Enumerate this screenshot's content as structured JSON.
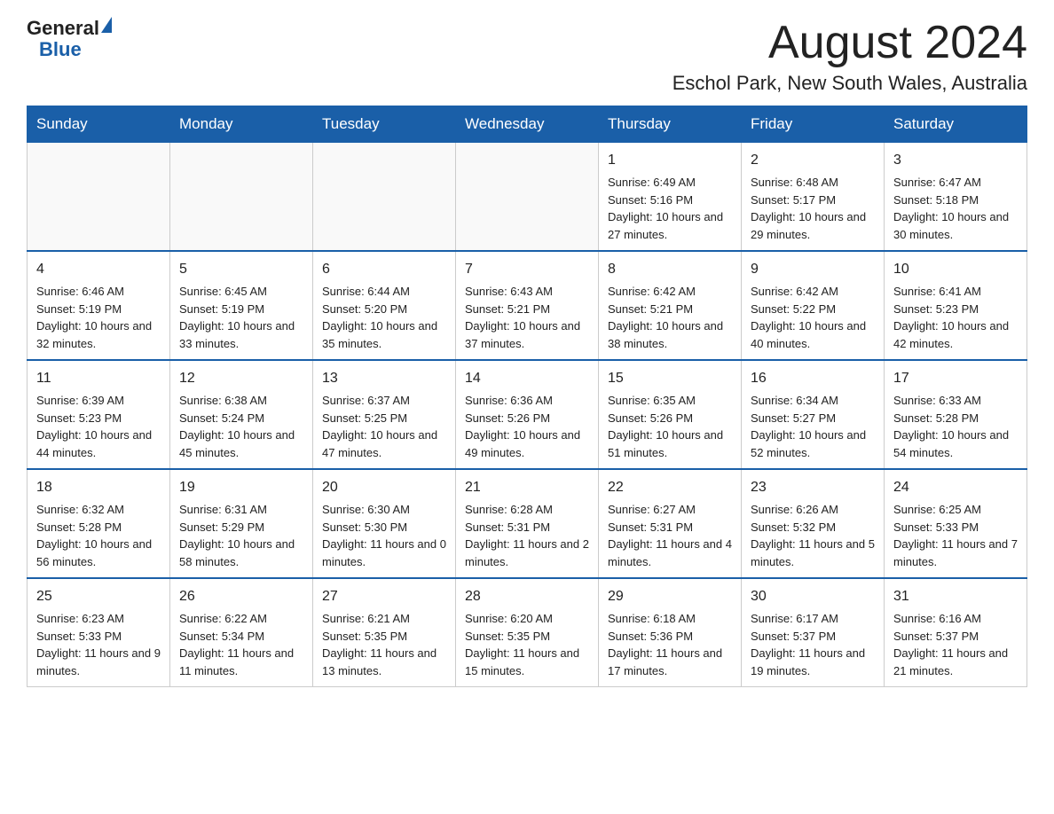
{
  "header": {
    "logo_line1": "General",
    "logo_line2": "Blue",
    "main_title": "August 2024",
    "subtitle": "Eschol Park, New South Wales, Australia"
  },
  "days_of_week": [
    "Sunday",
    "Monday",
    "Tuesday",
    "Wednesday",
    "Thursday",
    "Friday",
    "Saturday"
  ],
  "weeks": [
    [
      {
        "day": "",
        "info": ""
      },
      {
        "day": "",
        "info": ""
      },
      {
        "day": "",
        "info": ""
      },
      {
        "day": "",
        "info": ""
      },
      {
        "day": "1",
        "info": "Sunrise: 6:49 AM\nSunset: 5:16 PM\nDaylight: 10 hours and 27 minutes."
      },
      {
        "day": "2",
        "info": "Sunrise: 6:48 AM\nSunset: 5:17 PM\nDaylight: 10 hours and 29 minutes."
      },
      {
        "day": "3",
        "info": "Sunrise: 6:47 AM\nSunset: 5:18 PM\nDaylight: 10 hours and 30 minutes."
      }
    ],
    [
      {
        "day": "4",
        "info": "Sunrise: 6:46 AM\nSunset: 5:19 PM\nDaylight: 10 hours and 32 minutes."
      },
      {
        "day": "5",
        "info": "Sunrise: 6:45 AM\nSunset: 5:19 PM\nDaylight: 10 hours and 33 minutes."
      },
      {
        "day": "6",
        "info": "Sunrise: 6:44 AM\nSunset: 5:20 PM\nDaylight: 10 hours and 35 minutes."
      },
      {
        "day": "7",
        "info": "Sunrise: 6:43 AM\nSunset: 5:21 PM\nDaylight: 10 hours and 37 minutes."
      },
      {
        "day": "8",
        "info": "Sunrise: 6:42 AM\nSunset: 5:21 PM\nDaylight: 10 hours and 38 minutes."
      },
      {
        "day": "9",
        "info": "Sunrise: 6:42 AM\nSunset: 5:22 PM\nDaylight: 10 hours and 40 minutes."
      },
      {
        "day": "10",
        "info": "Sunrise: 6:41 AM\nSunset: 5:23 PM\nDaylight: 10 hours and 42 minutes."
      }
    ],
    [
      {
        "day": "11",
        "info": "Sunrise: 6:39 AM\nSunset: 5:23 PM\nDaylight: 10 hours and 44 minutes."
      },
      {
        "day": "12",
        "info": "Sunrise: 6:38 AM\nSunset: 5:24 PM\nDaylight: 10 hours and 45 minutes."
      },
      {
        "day": "13",
        "info": "Sunrise: 6:37 AM\nSunset: 5:25 PM\nDaylight: 10 hours and 47 minutes."
      },
      {
        "day": "14",
        "info": "Sunrise: 6:36 AM\nSunset: 5:26 PM\nDaylight: 10 hours and 49 minutes."
      },
      {
        "day": "15",
        "info": "Sunrise: 6:35 AM\nSunset: 5:26 PM\nDaylight: 10 hours and 51 minutes."
      },
      {
        "day": "16",
        "info": "Sunrise: 6:34 AM\nSunset: 5:27 PM\nDaylight: 10 hours and 52 minutes."
      },
      {
        "day": "17",
        "info": "Sunrise: 6:33 AM\nSunset: 5:28 PM\nDaylight: 10 hours and 54 minutes."
      }
    ],
    [
      {
        "day": "18",
        "info": "Sunrise: 6:32 AM\nSunset: 5:28 PM\nDaylight: 10 hours and 56 minutes."
      },
      {
        "day": "19",
        "info": "Sunrise: 6:31 AM\nSunset: 5:29 PM\nDaylight: 10 hours and 58 minutes."
      },
      {
        "day": "20",
        "info": "Sunrise: 6:30 AM\nSunset: 5:30 PM\nDaylight: 11 hours and 0 minutes."
      },
      {
        "day": "21",
        "info": "Sunrise: 6:28 AM\nSunset: 5:31 PM\nDaylight: 11 hours and 2 minutes."
      },
      {
        "day": "22",
        "info": "Sunrise: 6:27 AM\nSunset: 5:31 PM\nDaylight: 11 hours and 4 minutes."
      },
      {
        "day": "23",
        "info": "Sunrise: 6:26 AM\nSunset: 5:32 PM\nDaylight: 11 hours and 5 minutes."
      },
      {
        "day": "24",
        "info": "Sunrise: 6:25 AM\nSunset: 5:33 PM\nDaylight: 11 hours and 7 minutes."
      }
    ],
    [
      {
        "day": "25",
        "info": "Sunrise: 6:23 AM\nSunset: 5:33 PM\nDaylight: 11 hours and 9 minutes."
      },
      {
        "day": "26",
        "info": "Sunrise: 6:22 AM\nSunset: 5:34 PM\nDaylight: 11 hours and 11 minutes."
      },
      {
        "day": "27",
        "info": "Sunrise: 6:21 AM\nSunset: 5:35 PM\nDaylight: 11 hours and 13 minutes."
      },
      {
        "day": "28",
        "info": "Sunrise: 6:20 AM\nSunset: 5:35 PM\nDaylight: 11 hours and 15 minutes."
      },
      {
        "day": "29",
        "info": "Sunrise: 6:18 AM\nSunset: 5:36 PM\nDaylight: 11 hours and 17 minutes."
      },
      {
        "day": "30",
        "info": "Sunrise: 6:17 AM\nSunset: 5:37 PM\nDaylight: 11 hours and 19 minutes."
      },
      {
        "day": "31",
        "info": "Sunrise: 6:16 AM\nSunset: 5:37 PM\nDaylight: 11 hours and 21 minutes."
      }
    ]
  ]
}
